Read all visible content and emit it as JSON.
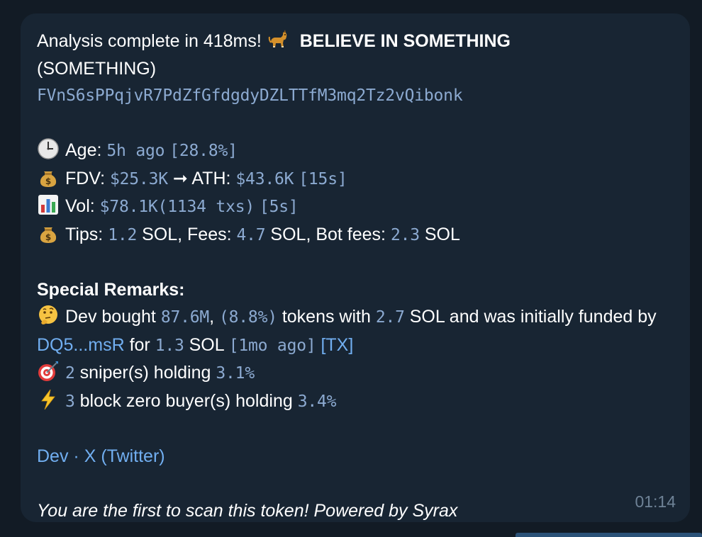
{
  "message": {
    "header": {
      "prefix": "Analysis complete in 418ms!",
      "token_name": "BELIEVE IN SOMETHING",
      "token_symbol": "(SOMETHING)",
      "contract_address": "FVnS6sPPqjvR7PdZfGfdgdyDZLTTfM3mq2Tz2vQibonk"
    },
    "stats": {
      "age_label": "Age:",
      "age_value": "5h ago",
      "age_pct": "[28.8%]",
      "fdv_label": "FDV:",
      "fdv_value": "$25.3K",
      "arrow": "➞",
      "ath_label": "ATH:",
      "ath_value": "$43.6K",
      "ath_time": "[15s]",
      "vol_label": "Vol:",
      "vol_value": "$78.1K",
      "vol_txs": "(1134 txs)",
      "vol_time": "[5s]",
      "tips_label": "Tips:",
      "tips_value": "1.2",
      "tips_unit": "SOL, Fees:",
      "fees_value": "4.7",
      "fees_unit": "SOL, Bot fees:",
      "botfees_value": "2.3",
      "botfees_unit": "SOL"
    },
    "remarks": {
      "title": "Special Remarks:",
      "dev_prefix": "Dev bought",
      "dev_amount": "87.6M",
      "dev_comma": ",",
      "dev_pct": "(8.8%)",
      "dev_mid": "tokens with",
      "dev_sol": "2.7",
      "dev_suffix": "SOL and was initially funded by",
      "funder": "DQ5...msR",
      "for_text": "for",
      "fund_amount": "1.3",
      "fund_unit": "SOL",
      "fund_time": "[1mo ago]",
      "tx_link": "[TX]",
      "snipers_count": "2",
      "snipers_text": "sniper(s) holding",
      "snipers_pct": "3.1%",
      "block0_count": "3",
      "block0_text": "block zero buyer(s) holding",
      "block0_pct": "3.4%"
    },
    "links": {
      "dev": "Dev",
      "separator": "·",
      "twitter": "X (Twitter)"
    },
    "footer": "You are the first to scan this token! Powered by Syrax",
    "time": "01:14"
  },
  "icons": {
    "dog": "dog-emoji-icon",
    "clock": "clock-emoji-icon",
    "money_bag": "money-bag-emoji-icon",
    "chart": "bar-chart-emoji-icon",
    "thinking": "thinking-face-emoji-icon",
    "target": "direct-hit-emoji-icon",
    "lightning": "high-voltage-emoji-icon"
  },
  "colors": {
    "background": "#121b25",
    "bubble": "#182533",
    "text": "#ffffff",
    "mono": "#8caad1",
    "link": "#71aef0",
    "timestamp": "#6e8296"
  }
}
